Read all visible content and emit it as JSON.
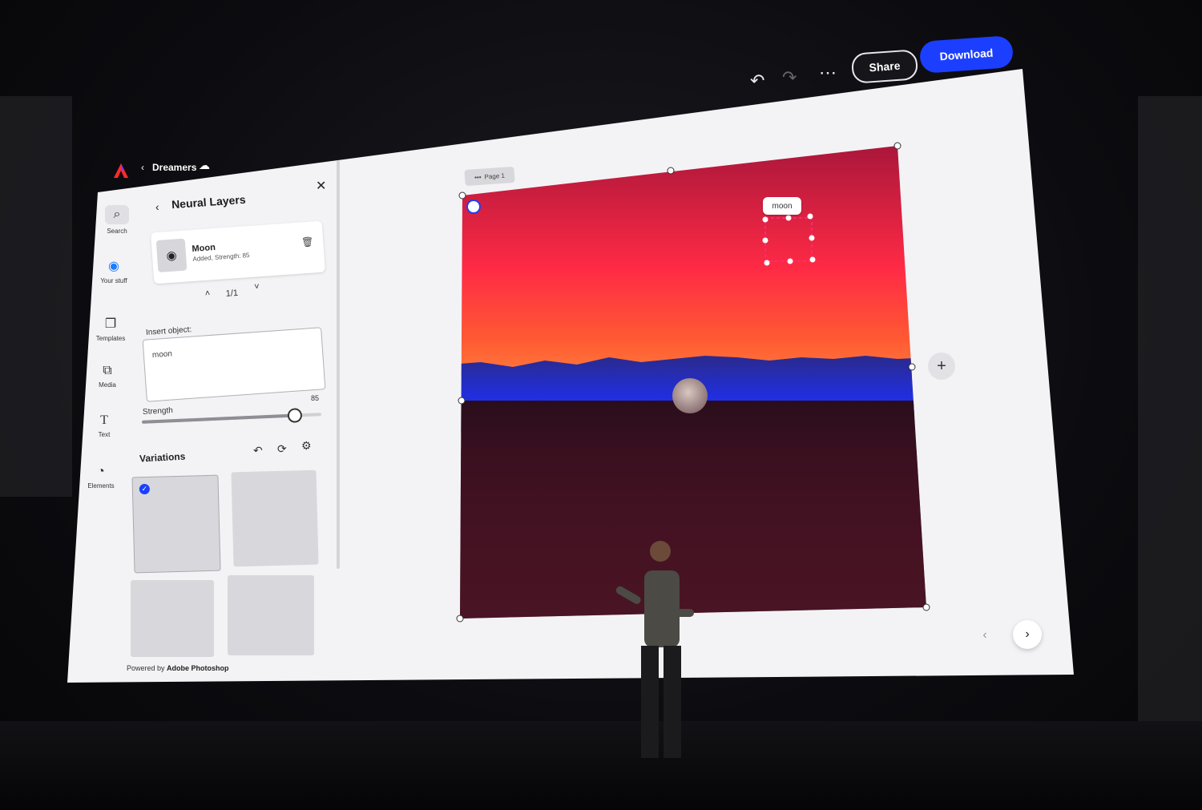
{
  "topbar": {
    "undo_icon": "undo-icon",
    "redo_icon": "redo-icon",
    "more_icon": "more-icon",
    "share_label": "Share",
    "download_label": "Download"
  },
  "appbar": {
    "project_name": "Dreamers"
  },
  "rail": {
    "items": [
      {
        "label": "Search",
        "icon": "search-icon"
      },
      {
        "label": "Your stuff",
        "icon": "globe-icon"
      },
      {
        "label": "Templates",
        "icon": "templates-icon"
      },
      {
        "label": "Media",
        "icon": "media-icon"
      },
      {
        "label": "Text",
        "icon": "text-icon"
      },
      {
        "label": "Elements",
        "icon": "elements-icon"
      }
    ]
  },
  "panel": {
    "title": "Neural Layers",
    "layer": {
      "name": "Moon",
      "meta": "Added, Strength: 85"
    },
    "pager": "1/1",
    "insert_label": "Insert object:",
    "insert_value": "moon",
    "strength_label": "Strength",
    "strength_value": "85",
    "strength_fraction": 0.85,
    "variations_label": "Variations",
    "powered_prefix": "Powered by",
    "powered_brand": "Adobe Photoshop"
  },
  "canvas": {
    "page_label": "Page 1",
    "moon_tag": "moon",
    "colors": {
      "sky_top": "#b0173a",
      "sky_mid": "#ff2a3c",
      "horizon": "#ff6a2a",
      "mountains": "#2a2fd0",
      "ground": "#3a0d1e"
    }
  }
}
